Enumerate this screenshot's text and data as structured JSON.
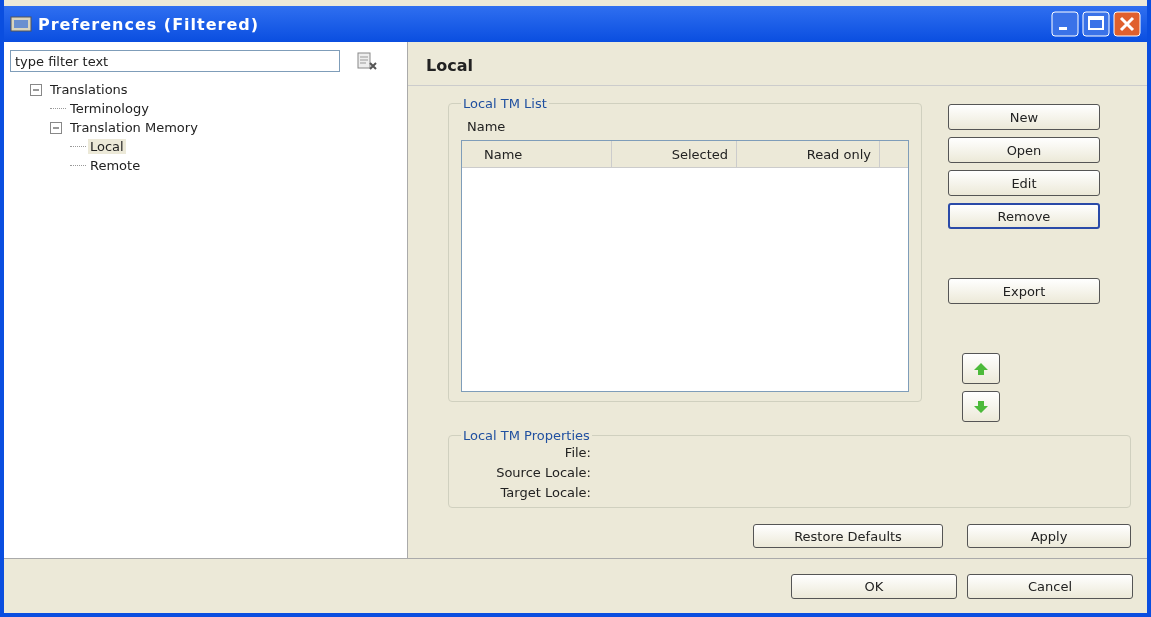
{
  "window": {
    "title": "Preferences (Filtered)"
  },
  "filter": {
    "placeholder": "type filter text"
  },
  "tree": [
    {
      "label": "Translations",
      "expanded": true,
      "selected": false,
      "children": [
        {
          "label": "Terminology",
          "selected": false
        },
        {
          "label": "Translation Memory",
          "expanded": true,
          "selected": false,
          "children": [
            {
              "label": "Local",
              "selected": true
            },
            {
              "label": "Remote",
              "selected": false
            }
          ]
        }
      ]
    }
  ],
  "page": {
    "title": "Local"
  },
  "tm_list": {
    "title": "Local TM List",
    "label": "Name",
    "columns": [
      "Name",
      "Selected",
      "Read only"
    ]
  },
  "side_buttons": [
    {
      "kind": "text",
      "label": "New",
      "focused": false
    },
    {
      "kind": "text",
      "label": "Open",
      "focused": false
    },
    {
      "kind": "text",
      "label": "Edit",
      "focused": false
    },
    {
      "kind": "text",
      "label": "Remove",
      "focused": true
    },
    {
      "kind": "gap"
    },
    {
      "kind": "text",
      "label": "Export",
      "focused": false
    },
    {
      "kind": "gap"
    },
    {
      "kind": "up"
    },
    {
      "kind": "down"
    }
  ],
  "properties": {
    "title": "Local TM Properties",
    "fields": [
      "File:",
      "Source Locale:",
      "Target Locale:"
    ]
  },
  "page_buttons": [
    "Restore Defaults",
    "Apply"
  ],
  "dialog_buttons": [
    "OK",
    "Cancel"
  ]
}
